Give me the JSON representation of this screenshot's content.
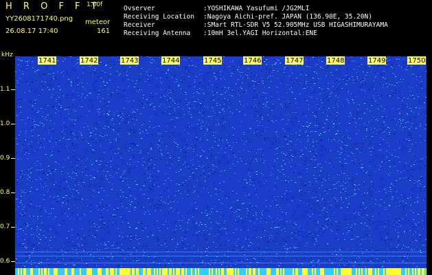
{
  "app": {
    "title": "H R O F F T",
    "version": "1.00f"
  },
  "file_name": "YY2608171740.png",
  "meteor_label": "meteor",
  "timestamp": "26.08.17 17:40",
  "meteor_count": "161",
  "info": [
    {
      "key": "Ovserver",
      "value": ":YOSHIKAWA Yasufumi /JG2MLI"
    },
    {
      "key": "Receiving Location",
      "value": ":Nagoya Aichi-pref. JAPAN (136.90E, 35.20N)"
    },
    {
      "key": "Receiver",
      "value": ":SMart RTL-SDR V5 52.905MHz USB HIGASHIMURAYAMA"
    },
    {
      "key": "Receiving Antenna",
      "value": ":10mH 3el.YAGI Horizontal:ENE"
    }
  ],
  "y_axis": {
    "unit": "kHz",
    "ticks": [
      "1.1",
      "1.0",
      "0.9",
      "0.8",
      "0.7",
      "0.6"
    ]
  },
  "time_labels": [
    "1741",
    "1742",
    "1743",
    "1744",
    "1745",
    "1746",
    "1747",
    "1748",
    "1749",
    "1750"
  ],
  "colors": {
    "label_text": "#ffff66",
    "info_text": "#ffffff",
    "spectrogram_base": "#1a3cc8",
    "noise_light": "#3fa0ff",
    "noise_cyan": "#3fe8ff",
    "noise_dark": "#0a1a8a",
    "baseline_band_yellow": "#ffff33",
    "baseline_band_cyan": "#33ccff"
  }
}
